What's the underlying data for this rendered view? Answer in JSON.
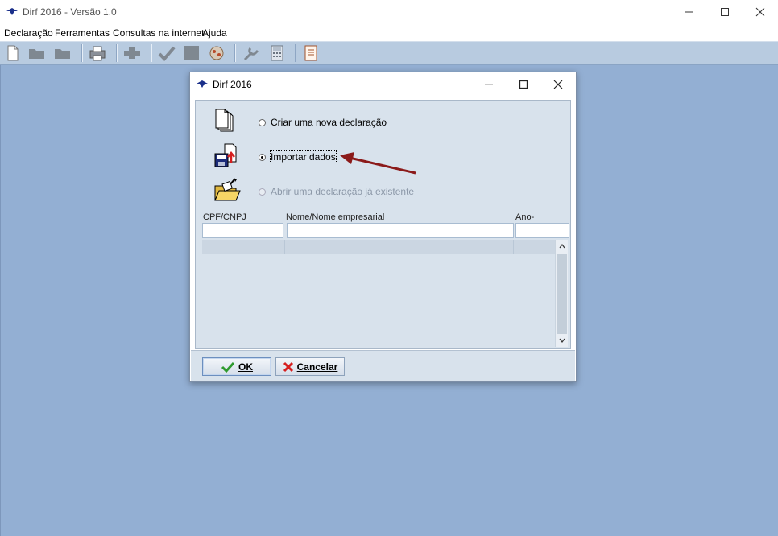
{
  "window": {
    "title": "Dirf 2016 - Versão 1.0"
  },
  "menu": [
    "Declaração",
    "Ferramentas",
    "Consultas na internet",
    "Ajuda"
  ],
  "toolbar_icons": [
    "new-file-icon",
    "open-folder-icon",
    "folder-icon",
    "print-icon",
    "pipe-icon",
    "check-icon",
    "stop-icon",
    "virus-icon",
    "tools-icon",
    "calculator-icon",
    "report-icon"
  ],
  "dialog": {
    "title": "Dirf 2016",
    "options": [
      {
        "label": "Criar uma nova declaração",
        "checked": false,
        "enabled": true
      },
      {
        "label": "Importar dados",
        "checked": true,
        "enabled": true
      },
      {
        "label": "Abrir uma declaração já existente",
        "checked": false,
        "enabled": false
      }
    ],
    "columns": [
      "CPF/CNPJ",
      "Nome/Nome empresarial",
      "Ano-calendário"
    ],
    "buttons": {
      "ok": "OK",
      "cancel": "Cancelar"
    }
  },
  "colors": {
    "workspace": "#93afd3",
    "toolbar": "#b8cbe0",
    "arrow": "#8b1a1a"
  }
}
